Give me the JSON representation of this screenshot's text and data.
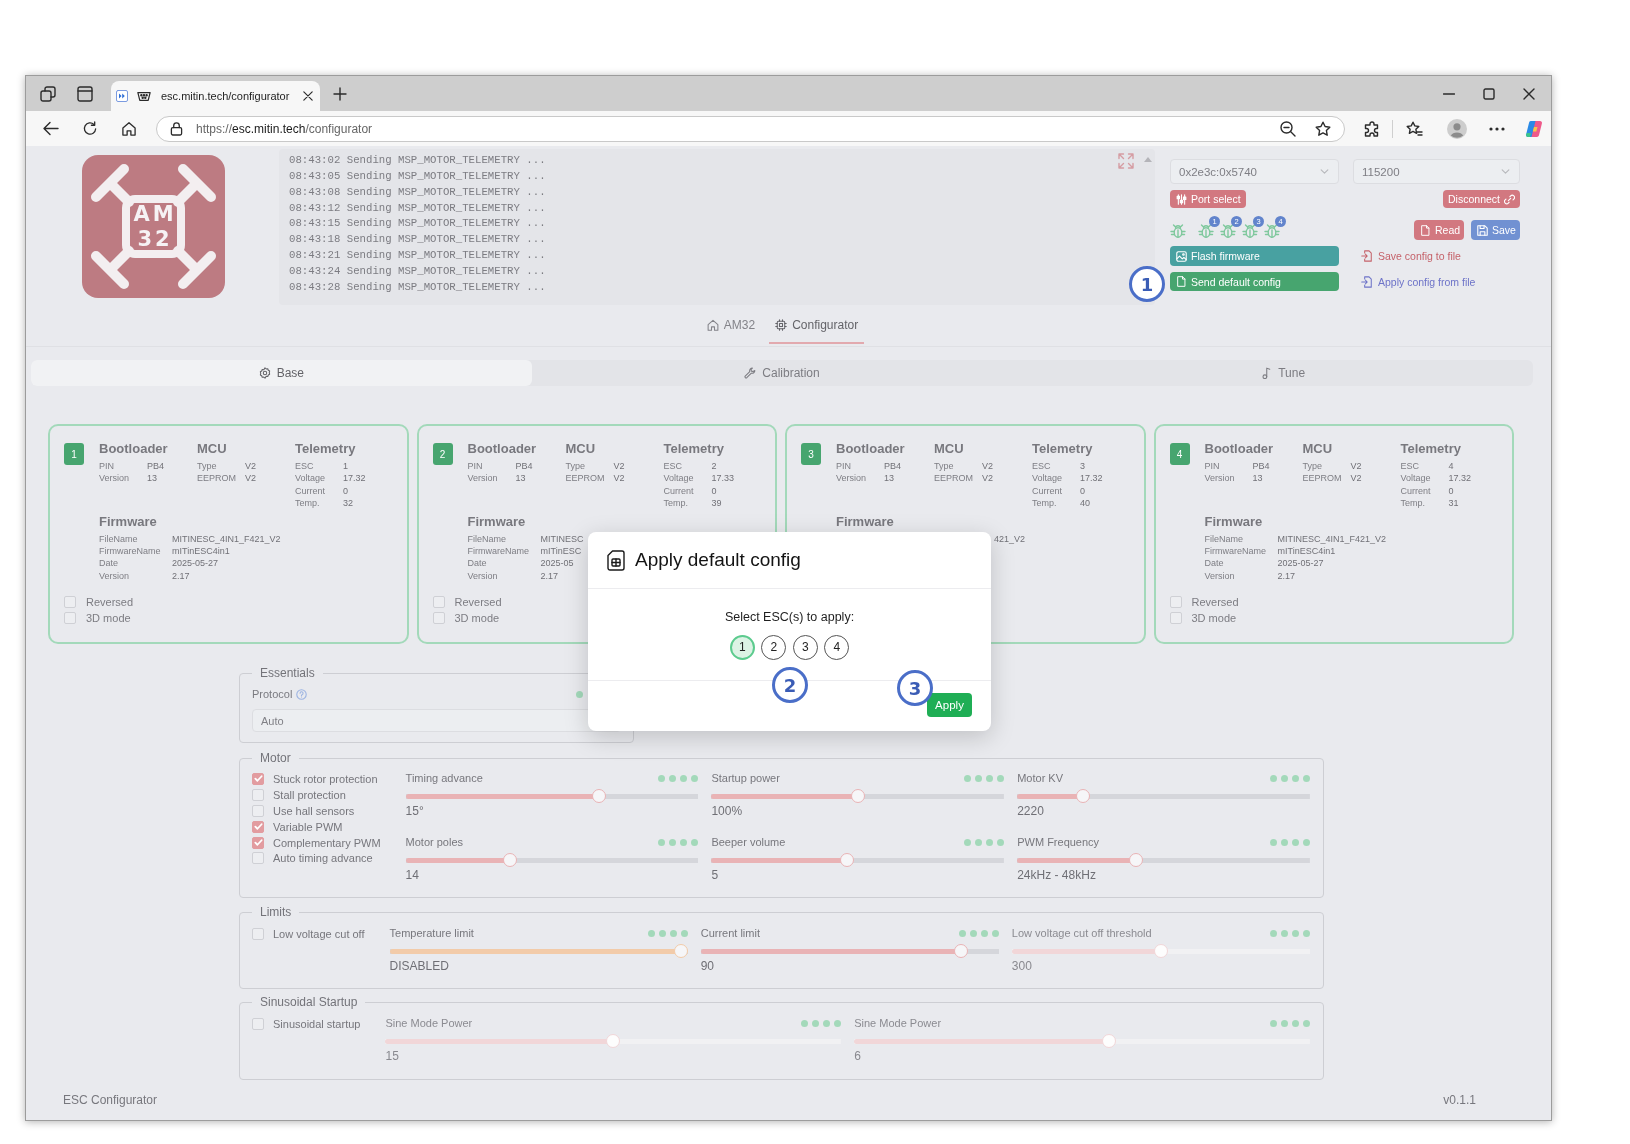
{
  "browser": {
    "tab": {
      "title": "esc.mitin.tech/configurator"
    },
    "address": "https://**esc.mitin.tech**/configurator"
  },
  "logo": {
    "lines": [
      "AM",
      "32"
    ]
  },
  "log": {
    "lines": [
      "08:43:02 Sending MSP_MOTOR_TELEMETRY ...",
      "08:43:05 Sending MSP_MOTOR_TELEMETRY ...",
      "08:43:08 Sending MSP_MOTOR_TELEMETRY ...",
      "08:43:12 Sending MSP_MOTOR_TELEMETRY ...",
      "08:43:15 Sending MSP_MOTOR_TELEMETRY ...",
      "08:43:18 Sending MSP_MOTOR_TELEMETRY ...",
      "08:43:21 Sending MSP_MOTOR_TELEMETRY ...",
      "08:43:24 Sending MSP_MOTOR_TELEMETRY ...",
      "08:43:28 Sending MSP_MOTOR_TELEMETRY ..."
    ]
  },
  "connection": {
    "port": {
      "value": "0x2e3c:0x5740"
    },
    "baud": {
      "value": "115200"
    },
    "port_select": "Port select",
    "disconnect": "Disconnect",
    "esc_indicators": [
      {
        "kind": "plain"
      },
      {
        "kind": "numbered",
        "badge": "1"
      },
      {
        "kind": "numbered",
        "badge": "2"
      },
      {
        "kind": "numbered",
        "badge": "3"
      },
      {
        "kind": "numbered",
        "badge": "4"
      }
    ],
    "read": "Read",
    "save": "Save",
    "flash_firmware": "Flash firmware",
    "send_default_config": "Send default config",
    "save_config_to_file": "Save config to file",
    "apply_config_from_file": "Apply config from file",
    "marker": "1"
  },
  "nav": [
    {
      "label": "AM32",
      "selected": false
    },
    {
      "label": "Configurator",
      "selected": true
    }
  ],
  "tabs": [
    {
      "label": "Base",
      "selected": true
    },
    {
      "label": "Calibration",
      "selected": false
    },
    {
      "label": "Tune",
      "selected": false
    }
  ],
  "escs": [
    {
      "number": "1",
      "sections": [
        {
          "title": "Bootloader",
          "rows": [
            {
              "label": "PIN",
              "value": "PB4"
            },
            {
              "label": "Version",
              "value": "13"
            }
          ]
        },
        {
          "title": "MCU",
          "rows": [
            {
              "label": "Type",
              "value": "V2"
            },
            {
              "label": "EEPROM",
              "value": "V2"
            }
          ]
        },
        {
          "title": "Telemetry",
          "rows": [
            {
              "label": "ESC",
              "value": "1"
            },
            {
              "label": "Voltage",
              "value": "17.32"
            },
            {
              "label": "Current",
              "value": "0"
            },
            {
              "label": "Temp.",
              "value": "32"
            }
          ]
        }
      ],
      "firmware": {
        "title": "Firmware",
        "rows": [
          {
            "label": "FileName",
            "value": "MITINESC_4IN1_F421_V2"
          },
          {
            "label": "FirmwareName",
            "value": "mITinESC4in1"
          },
          {
            "label": "Date",
            "value": "2025-05-27"
          },
          {
            "label": "Version",
            "value": "2.17"
          }
        ]
      },
      "options": [
        {
          "label": "Reversed",
          "checked": false
        },
        {
          "label": "3D mode",
          "checked": false
        }
      ]
    },
    {
      "number": "2",
      "sections": [
        {
          "title": "Bootloader",
          "rows": [
            {
              "label": "PIN",
              "value": "PB4"
            },
            {
              "label": "Version",
              "value": "13"
            }
          ]
        },
        {
          "title": "MCU",
          "rows": [
            {
              "label": "Type",
              "value": "V2"
            },
            {
              "label": "EEPROM",
              "value": "V2"
            }
          ]
        },
        {
          "title": "Telemetry",
          "rows": [
            {
              "label": "ESC",
              "value": "2"
            },
            {
              "label": "Voltage",
              "value": "17.33"
            },
            {
              "label": "Current",
              "value": "0"
            },
            {
              "label": "Temp.",
              "value": "39"
            }
          ]
        }
      ],
      "firmware": {
        "title": "Firmware",
        "rows": [
          {
            "label": "FileName",
            "value": "MITINESC"
          },
          {
            "label": "FirmwareName",
            "value": "mITinESC"
          },
          {
            "label": "Date",
            "value": "2025-05"
          },
          {
            "label": "Version",
            "value": "2.17"
          }
        ]
      },
      "options": [
        {
          "label": "Reversed",
          "checked": false
        },
        {
          "label": "3D mode",
          "checked": false
        }
      ]
    },
    {
      "number": "3",
      "sections": [
        {
          "title": "Bootloader",
          "rows": [
            {
              "label": "PIN",
              "value": "PB4"
            },
            {
              "label": "Version",
              "value": "13"
            }
          ]
        },
        {
          "title": "MCU",
          "rows": [
            {
              "label": "Type",
              "value": "V2"
            },
            {
              "label": "EEPROM",
              "value": "V2"
            }
          ]
        },
        {
          "title": "Telemetry",
          "rows": [
            {
              "label": "ESC",
              "value": "3"
            },
            {
              "label": "Voltage",
              "value": "17.32"
            },
            {
              "label": "Current",
              "value": "0"
            },
            {
              "label": "Temp.",
              "value": "40"
            }
          ]
        }
      ],
      "firmware": {
        "title": "Firmware",
        "rows": [
          {
            "value": "421_V2",
            "clipped_start": true
          }
        ]
      }
    },
    {
      "number": "4",
      "sections": [
        {
          "title": "Bootloader",
          "rows": [
            {
              "label": "PIN",
              "value": "PB4"
            },
            {
              "label": "Version",
              "value": "13"
            }
          ]
        },
        {
          "title": "MCU",
          "rows": [
            {
              "label": "Type",
              "value": "V2"
            },
            {
              "label": "EEPROM",
              "value": "V2"
            }
          ]
        },
        {
          "title": "Telemetry",
          "rows": [
            {
              "label": "ESC",
              "value": "4"
            },
            {
              "label": "Voltage",
              "value": "17.32"
            },
            {
              "label": "Current",
              "value": "0"
            },
            {
              "label": "Temp.",
              "value": "31"
            }
          ]
        }
      ],
      "firmware": {
        "title": "Firmware",
        "rows": [
          {
            "label": "FileName",
            "value": "MITINESC_4IN1_F421_V2"
          },
          {
            "label": "FirmwareName",
            "value": "mITinESC4in1"
          },
          {
            "label": "Date",
            "value": "2025-05-27"
          },
          {
            "label": "Version",
            "value": "2.17"
          }
        ]
      },
      "options": [
        {
          "label": "Reversed",
          "checked": false
        },
        {
          "label": "3D mode",
          "checked": false
        }
      ]
    }
  ],
  "essentials": {
    "title": "Essentials",
    "protocol": {
      "label": "Protocol",
      "value": "Auto"
    }
  },
  "motor": {
    "title": "Motor",
    "options": [
      {
        "label": "Stuck rotor protection",
        "checked": true
      },
      {
        "label": "Stall protection",
        "checked": false
      },
      {
        "label": "Use hall sensors",
        "checked": false
      },
      {
        "label": "Variable PWM",
        "checked": true
      },
      {
        "label": "Complementary PWM",
        "checked": true
      },
      {
        "label": "Auto timing advance",
        "checked": false
      }
    ],
    "sliders": [
      {
        "label": "Timing advance",
        "level": 0.67,
        "reading": "15°",
        "color": "#e9b3b5",
        "disabled": false
      },
      {
        "label": "Startup power",
        "level": 0.5,
        "reading": "100%",
        "color": "#e9b3b5",
        "disabled": false
      },
      {
        "label": "Motor KV",
        "level": 0.21,
        "reading": "2220",
        "color": "#e9b3b5",
        "disabled": false
      },
      {
        "label": "Motor poles",
        "level": 0.35,
        "reading": "14",
        "color": "#e9b3b5",
        "disabled": false
      },
      {
        "label": "Beeper volume",
        "level": 0.46,
        "reading": "5",
        "color": "#e9b3b5",
        "disabled": false
      },
      {
        "label": "PWM Frequency",
        "level": 0.4,
        "reading": "24kHz - 48kHz",
        "color": "#e9b3b5",
        "disabled": false
      }
    ]
  },
  "limits": {
    "title": "Limits",
    "options": [
      {
        "label": "Low voltage cut off",
        "checked": false
      }
    ],
    "sliders": [
      {
        "label": "Temperature limit",
        "level": 1,
        "reading": "DISABLED",
        "color": "#f2cba9",
        "disabled": false
      },
      {
        "label": "Current limit",
        "level": 0.89,
        "reading": "90",
        "color": "#e9b3b5",
        "disabled": false
      },
      {
        "label": "Low voltage cut off threshold",
        "level": 0.5,
        "reading": "300",
        "color": "#f1d6d8",
        "disabled": true
      }
    ]
  },
  "sinusoidal_startup": {
    "title": "Sinusoidal Startup",
    "options": [
      {
        "label": "Sinusoidal startup",
        "checked": false
      }
    ],
    "sliders": [
      {
        "label": "Sine Mode Power",
        "level": 0.5,
        "reading": "15",
        "color": "#f1d6d8",
        "disabled": true
      },
      {
        "label": "Sine Mode Power",
        "level": 0.56,
        "reading": "6",
        "color": "#f1d6d8",
        "disabled": true
      }
    ]
  },
  "modal": {
    "title": "Apply default config",
    "prompt": "Select ESC(s) to apply:",
    "escs": [
      {
        "label": "1",
        "selected": true
      },
      {
        "label": "2",
        "selected": false
      },
      {
        "label": "3",
        "selected": false
      },
      {
        "label": "4",
        "selected": false
      }
    ],
    "apply": "Apply",
    "markers": [
      "2",
      "3"
    ]
  },
  "footer": {
    "app_name": "ESC Configurator",
    "version": "v0.1.1"
  }
}
